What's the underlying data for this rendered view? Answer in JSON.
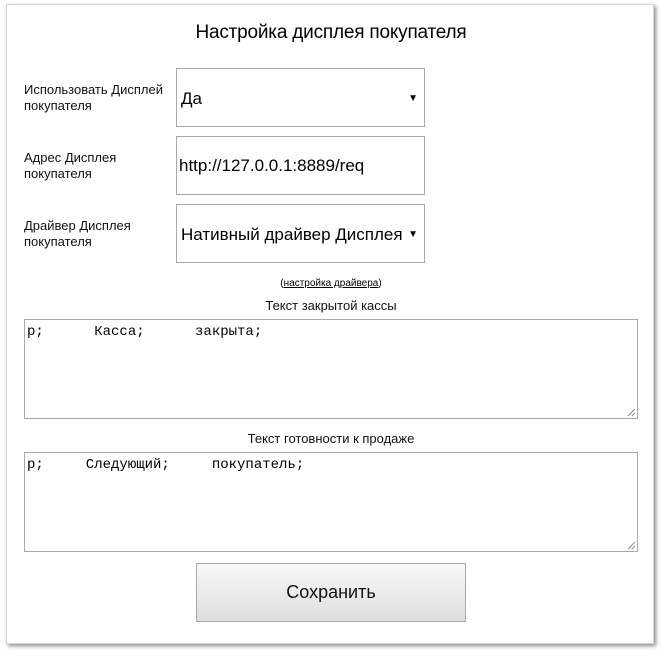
{
  "title": "Настройка дисплея покупателя",
  "fields": {
    "use_display": {
      "label": "Использовать Дисплей покупателя",
      "value": "Да"
    },
    "display_address": {
      "label": "Адрес Дисплея покупателя",
      "value": "http://127.0.0.1:8889/req"
    },
    "display_driver": {
      "label": "Драйвер Дисплея покупателя",
      "value": "Нативный драйвер Дисплея"
    }
  },
  "driver_settings_link": {
    "open": "(",
    "label": "настройка драйвера",
    "close": ")"
  },
  "closed_text": {
    "label": "Текст закрытой кассы",
    "value": "р;      Касса;      закрыта;"
  },
  "ready_text": {
    "label": "Текст готовности к продаже",
    "value": "р;     Следующий;     покупатель;"
  },
  "save_button": {
    "label": "Сохранить"
  }
}
